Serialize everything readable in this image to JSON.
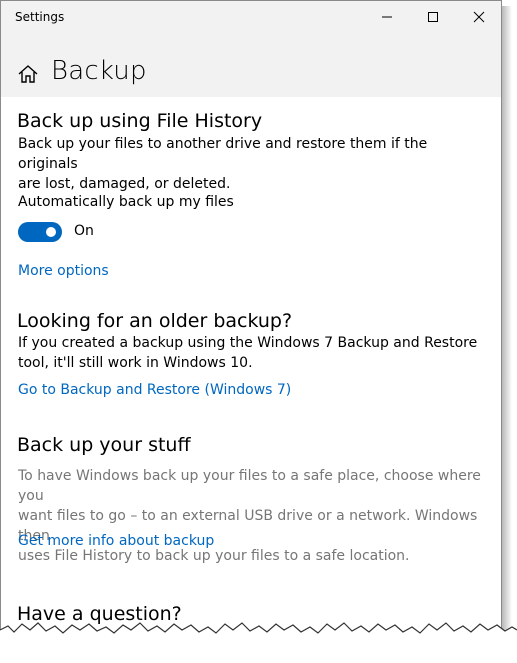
{
  "window": {
    "title": "Settings",
    "controls": {
      "minimize": "—",
      "maximize": "☐",
      "close": "✕"
    }
  },
  "header": {
    "title": "Backup",
    "home_icon": "home-icon"
  },
  "file_history": {
    "heading": "Back up using File History",
    "description_line1": "Back up your files to another drive and restore them if the originals",
    "description_line2": "are lost, damaged, or deleted.",
    "auto_backup_label": "Automatically back up my files",
    "toggle_state": "On",
    "more_options": "More options"
  },
  "older_backup": {
    "heading": "Looking for an older backup?",
    "description_line1": "If you created a backup using the Windows 7 Backup and Restore",
    "description_line2": "tool, it'll still work in Windows 10.",
    "link": "Go to Backup and Restore (Windows 7)"
  },
  "backup_stuff": {
    "heading": "Back up your stuff",
    "description_line1": "To have Windows back up your files to a safe place, choose where you",
    "description_line2": "want files to go – to an external USB drive or a network. Windows then",
    "description_line3": "uses File History to back up your files to a safe location.",
    "link": "Get more info about backup"
  },
  "question": {
    "heading": "Have a question?"
  },
  "colors": {
    "accent": "#0067c0",
    "muted_text": "#767676",
    "header_bg": "#f2f2f2"
  }
}
